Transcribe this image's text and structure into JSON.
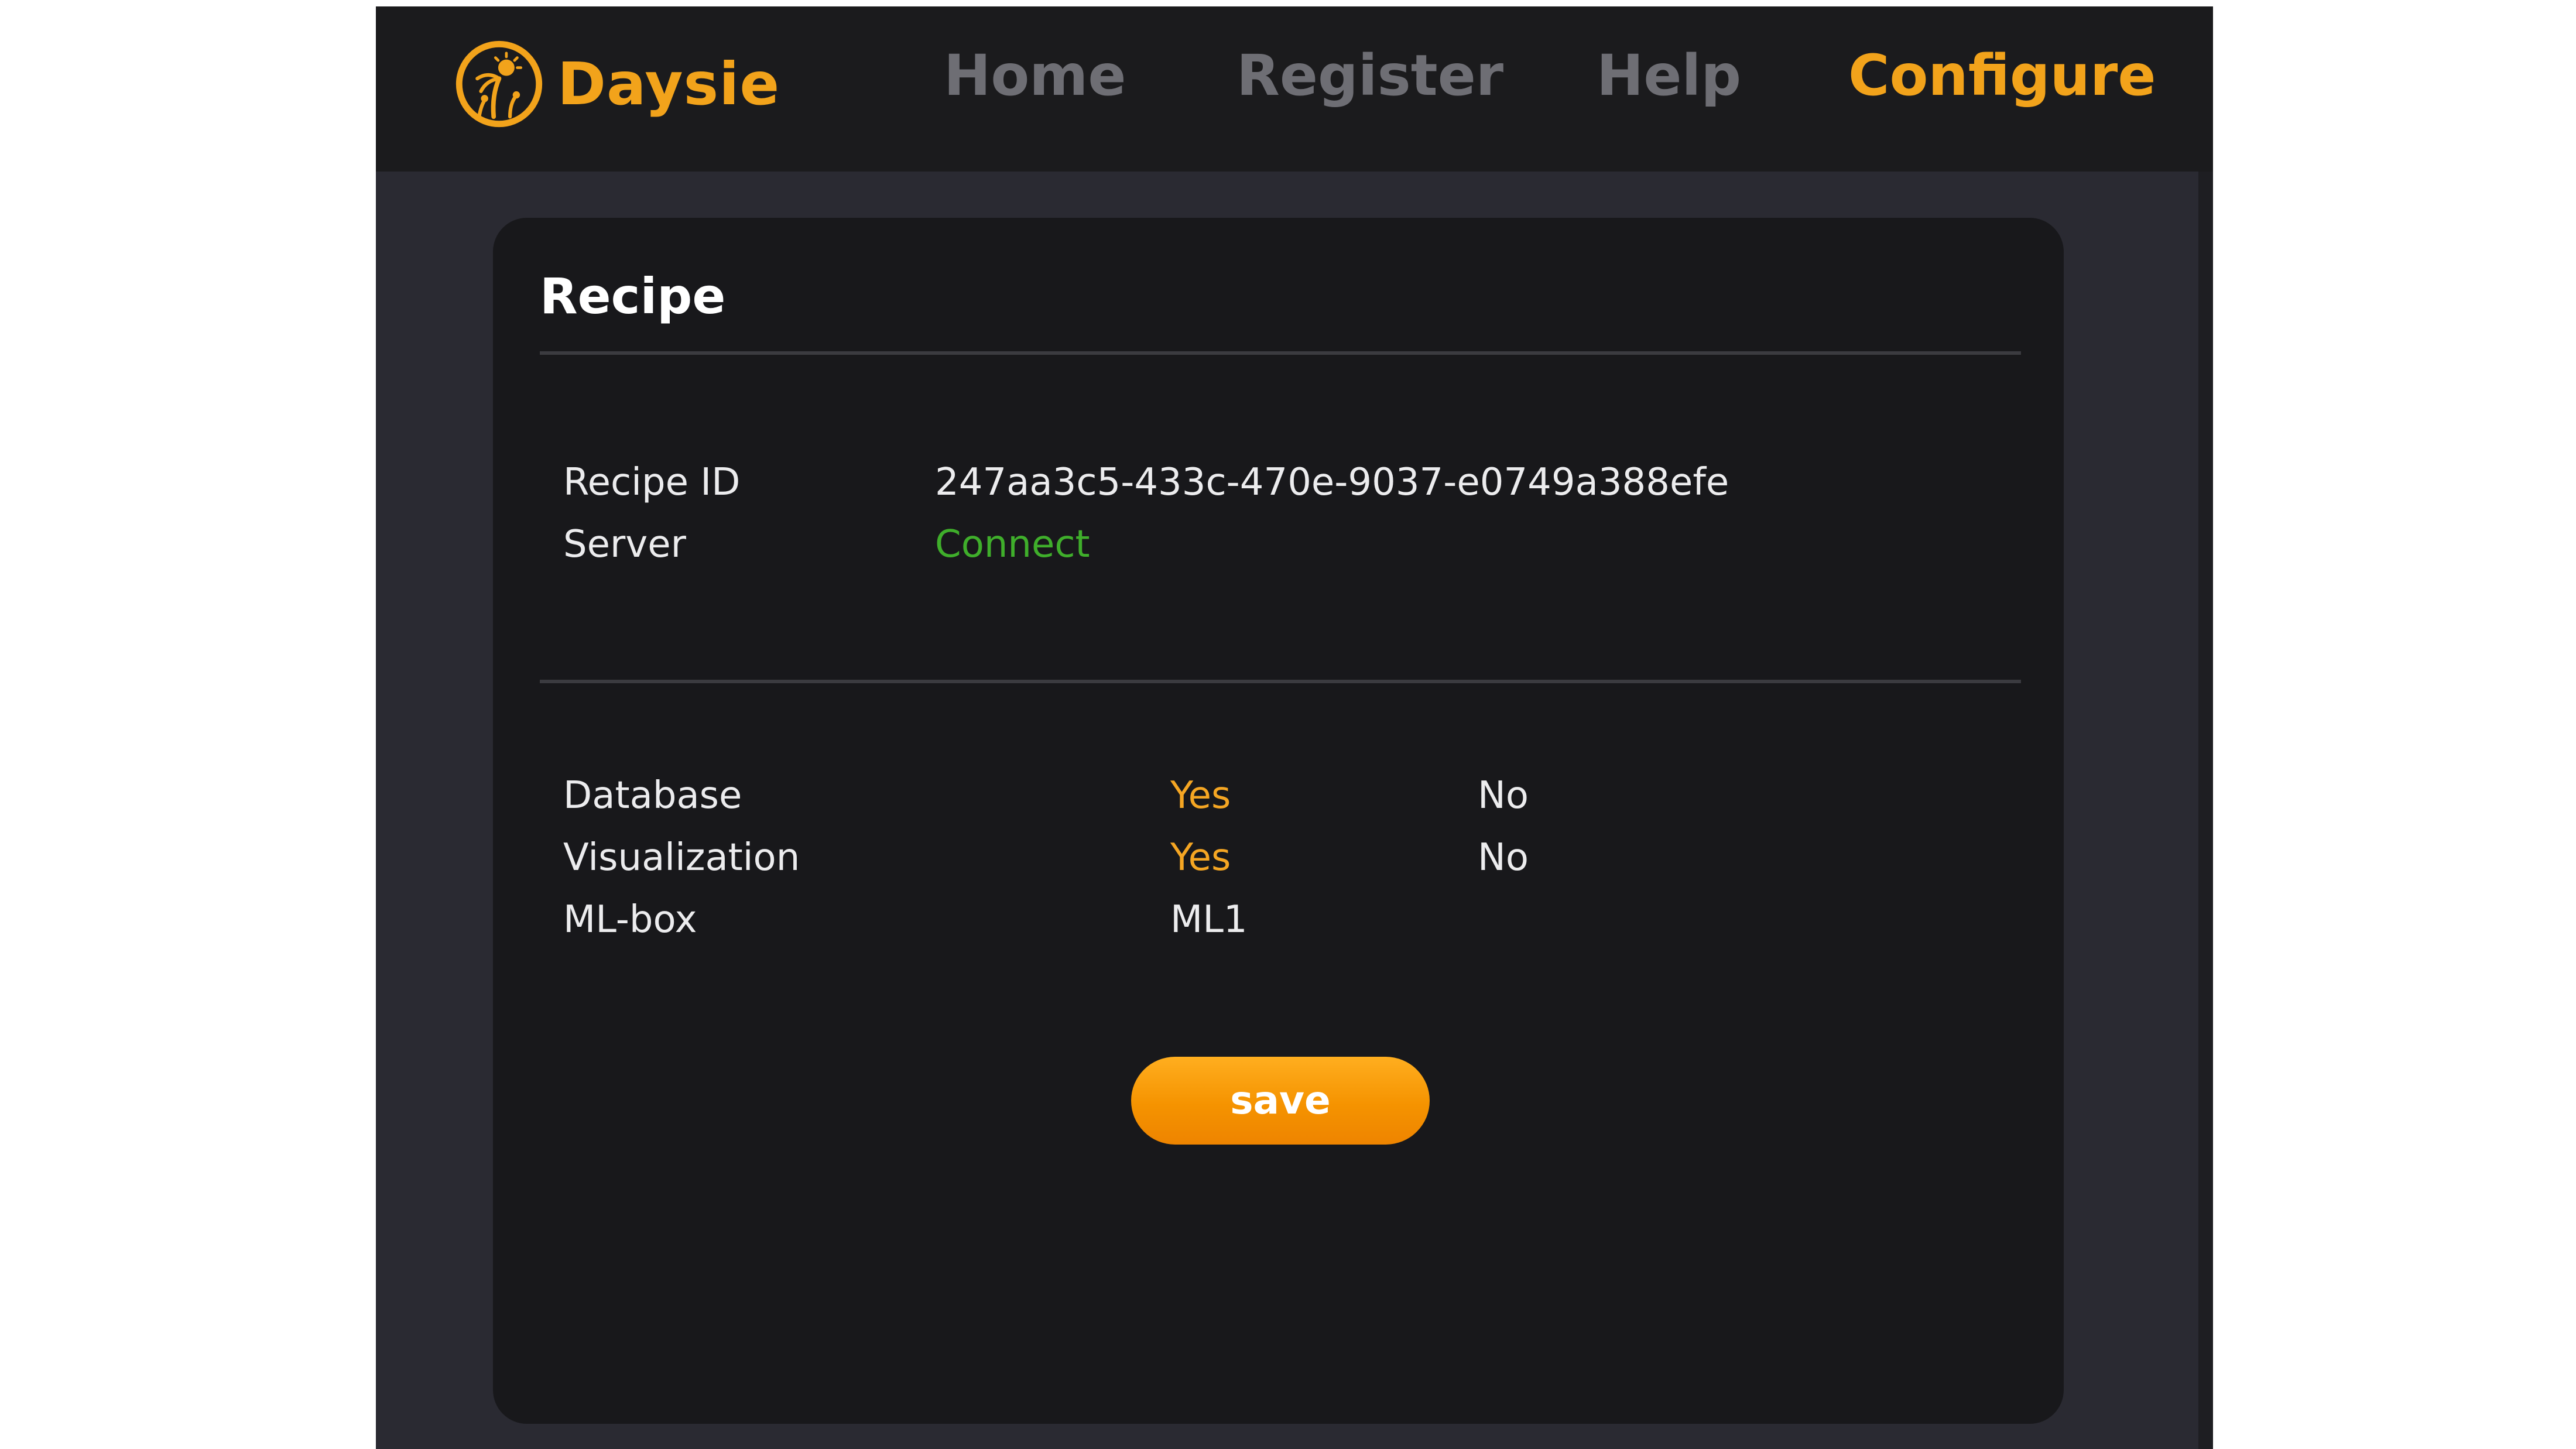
{
  "app": {
    "name": "Daysie",
    "logo_icon": "palm-tree-sun-icon",
    "accent_color": "#f2a31b"
  },
  "nav": {
    "items": [
      {
        "label": "Home",
        "active": false
      },
      {
        "label": "Register",
        "active": false
      },
      {
        "label": "Help",
        "active": false
      },
      {
        "label": "Configure",
        "active": true
      }
    ]
  },
  "recipe": {
    "title": "Recipe",
    "fields": [
      {
        "label": "Recipe ID",
        "value": "247aa3c5-433c-470e-9037-e0749a388efe"
      },
      {
        "label": "Server",
        "value": "Connect",
        "value_color": "#3fae2b"
      }
    ],
    "options": [
      {
        "label": "Database",
        "choices": [
          "Yes",
          "No"
        ],
        "selected": "Yes"
      },
      {
        "label": "Visualization",
        "choices": [
          "Yes",
          "No"
        ],
        "selected": "Yes"
      },
      {
        "label": "ML-box",
        "value": "ML1"
      }
    ],
    "save_label": "save"
  }
}
